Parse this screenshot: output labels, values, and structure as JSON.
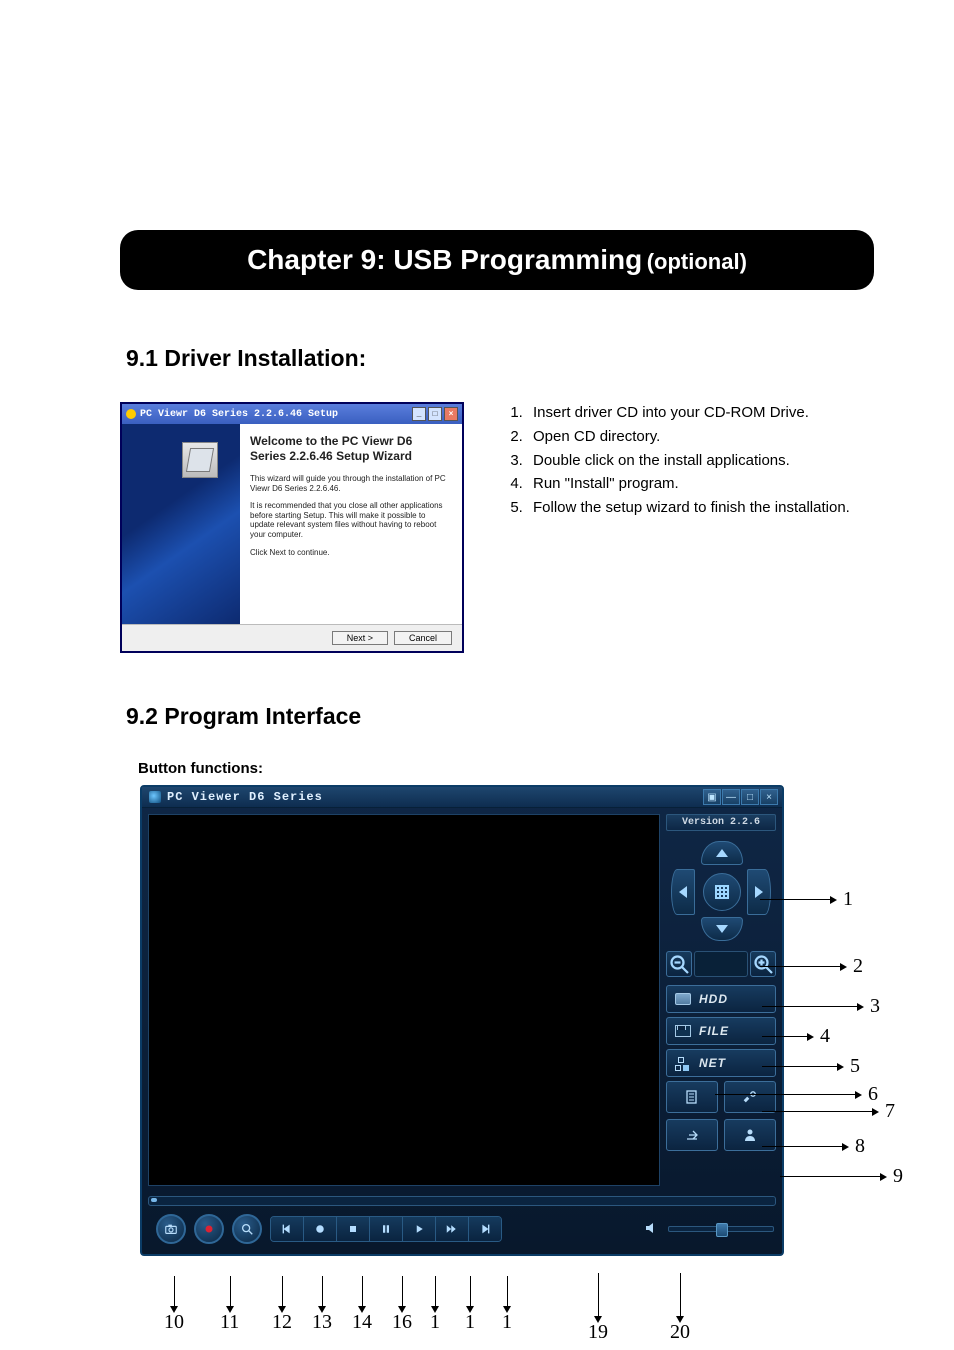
{
  "chapter": {
    "main": "Chapter 9: USB Programming",
    "optional": "(optional)"
  },
  "section91": "9.1 Driver Installation:",
  "section92": "9.2 Program Interface",
  "button_functions_label": "Button functions:",
  "wizard": {
    "titlebar": "PC Viewr D6 Series 2.2.6.46 Setup",
    "heading": "Welcome to the PC Viewr D6 Series 2.2.6.46 Setup Wizard",
    "p1": "This wizard will guide you through the installation of PC Viewr D6 Series 2.2.6.46.",
    "p2": "It is recommended that you close all other applications before starting Setup. This will make it possible to update relevant system files without having to reboot your computer.",
    "p3": "Click Next to continue.",
    "next": "Next >",
    "cancel": "Cancel"
  },
  "steps": [
    "Insert driver CD into your CD-ROM Drive.",
    "Open CD directory.",
    "Double click on the install applications.",
    "Run \"Install\" program.",
    "Follow the setup wizard to finish the installation."
  ],
  "iface": {
    "app_name": "PC Viewer D6 Series",
    "version": "Version 2.2.6",
    "hdd": "HDD",
    "file": "FILE",
    "net": "NET"
  },
  "callouts_right": {
    "1": "1",
    "2": "2",
    "3": "3",
    "4": "4",
    "5": "5",
    "6": "6",
    "7": "7",
    "8": "8",
    "9": "9"
  },
  "callouts_bottom": {
    "10": "10",
    "11": "11",
    "12": "12",
    "13": "13",
    "14": "14",
    "16": "16",
    "17a": "1",
    "17b": "1",
    "17c": "1",
    "19": "19",
    "20": "20"
  }
}
